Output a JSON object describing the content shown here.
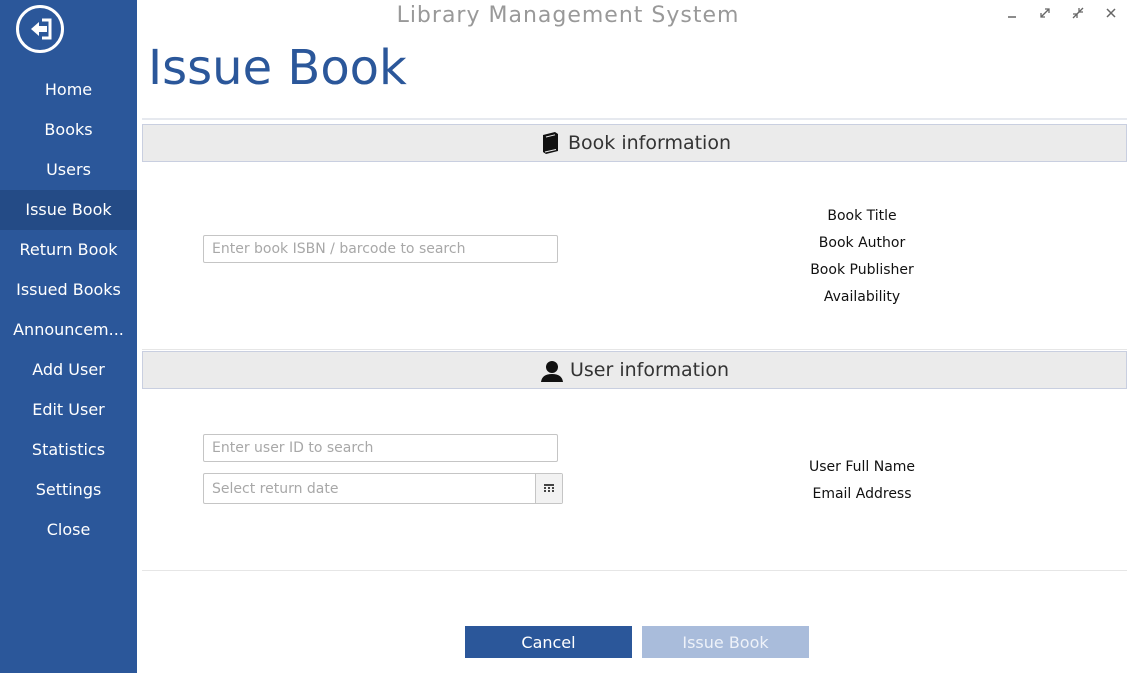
{
  "window": {
    "title": "Library Management System",
    "controls": [
      "minimize-icon",
      "maximize-icon",
      "restore-icon",
      "close-icon"
    ]
  },
  "sidebar": {
    "logout_icon": "logout-icon",
    "items": [
      {
        "label": "Home"
      },
      {
        "label": "Books"
      },
      {
        "label": "Users"
      },
      {
        "label": "Issue Book",
        "active": true
      },
      {
        "label": "Return Book"
      },
      {
        "label": "Issued Books"
      },
      {
        "label": "Announcem..."
      },
      {
        "label": "Add User"
      },
      {
        "label": "Edit User"
      },
      {
        "label": "Statistics"
      },
      {
        "label": "Settings"
      },
      {
        "label": "Close"
      }
    ]
  },
  "page": {
    "title": "Issue Book"
  },
  "book_section": {
    "heading": "Book information",
    "icon": "book-icon",
    "search_placeholder": "Enter book ISBN / barcode to search",
    "search_value": "",
    "labels": {
      "title": "Book Title",
      "author": "Book Author",
      "publisher": "Book Publisher",
      "availability": "Availability"
    }
  },
  "user_section": {
    "heading": "User information",
    "icon": "user-icon",
    "search_placeholder": "Enter user ID to search",
    "search_value": "",
    "date_placeholder": "Select return date",
    "date_icon": "calendar-icon",
    "labels": {
      "full_name": "User Full Name",
      "email": "Email Address"
    }
  },
  "actions": {
    "cancel_label": "Cancel",
    "issue_label": "Issue Book"
  },
  "colors": {
    "primary": "#2b579a",
    "primary_disabled": "#a9bcdb",
    "section_header_bg": "#ebebeb"
  }
}
